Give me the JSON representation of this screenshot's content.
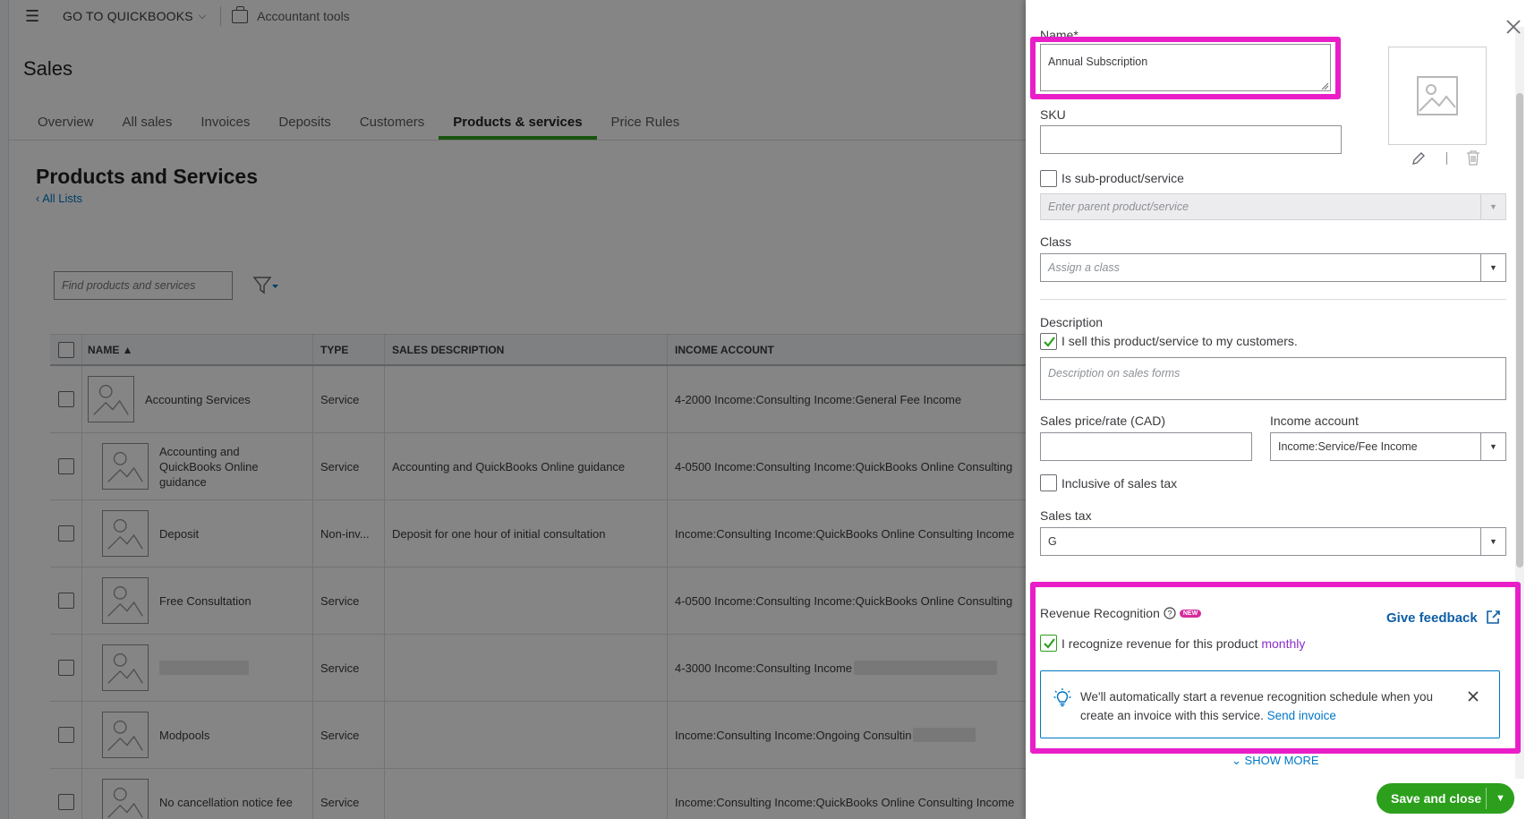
{
  "topbar": {
    "goto": "GO TO QUICKBOOKS",
    "accountant_tools": "Accountant tools"
  },
  "page": {
    "title": "Sales",
    "tabs": [
      {
        "label": "Overview",
        "active": false
      },
      {
        "label": "All sales",
        "active": false
      },
      {
        "label": "Invoices",
        "active": false
      },
      {
        "label": "Deposits",
        "active": false
      },
      {
        "label": "Customers",
        "active": false
      },
      {
        "label": "Products & services",
        "active": true
      },
      {
        "label": "Price Rules",
        "active": false
      }
    ],
    "section_title": "Products and Services",
    "back_link": "All Lists",
    "search_placeholder": "Find products and services"
  },
  "table": {
    "headers": {
      "name": "NAME ▲",
      "type": "TYPE",
      "description": "SALES DESCRIPTION",
      "income": "INCOME ACCOUNT"
    },
    "rows": [
      {
        "name": "Accounting Services",
        "type": "Service",
        "description": "",
        "income": "4-2000 Income:Consulting Income:General Fee Income"
      },
      {
        "name": "Accounting and QuickBooks Online guidance",
        "type": "Service",
        "description": "Accounting and QuickBooks Online guidance",
        "income": "4-0500 Income:Consulting Income:QuickBooks Online Consulting"
      },
      {
        "name": "Deposit",
        "type": "Non-inv...",
        "description": "Deposit for one hour of initial consultation",
        "income": "Income:Consulting Income:QuickBooks Online Consulting Income"
      },
      {
        "name": "Free Consultation",
        "type": "Service",
        "description": "",
        "income": "4-0500 Income:Consulting Income:QuickBooks Online Consulting"
      },
      {
        "name": "",
        "type": "Service",
        "description": "",
        "income": "4-3000 Income:Consulting Income"
      },
      {
        "name": "Modpools",
        "type": "Service",
        "description": "",
        "income": "Income:Consulting Income:Ongoing Consultin"
      },
      {
        "name": "No cancellation notice fee",
        "type": "Service",
        "description": "",
        "income": "Income:Consulting Income:QuickBooks Online Consulting Income"
      }
    ]
  },
  "drawer": {
    "name_label": "Name*",
    "name_value": "Annual Subscription",
    "sku_label": "SKU",
    "sku_value": "",
    "sub_product_label": "Is sub-product/service",
    "parent_placeholder": "Enter parent product/service",
    "class_label": "Class",
    "class_placeholder": "Assign a class",
    "description_label": "Description",
    "sell_label": "I sell this product/service to my customers.",
    "description_placeholder": "Description on sales forms",
    "price_label": "Sales price/rate (CAD)",
    "price_value": "",
    "income_label": "Income account",
    "income_value": "Income:Service/Fee Income",
    "inclusive_label": "Inclusive of sales tax",
    "sales_tax_label": "Sales tax",
    "sales_tax_value": "G",
    "revrec_label": "Revenue Recognition",
    "new_badge": "NEW",
    "give_feedback": "Give feedback",
    "recognize_label": "I recognize revenue for this product",
    "recognize_freq": "monthly",
    "info_text": "We'll automatically start a revenue recognition schedule when you create an invoice with this service.",
    "send_invoice": "Send invoice",
    "show_more": "SHOW MORE",
    "save_close": "Save and close"
  },
  "colors": {
    "accent_green": "#2ca01c",
    "link_blue": "#0077c5",
    "highlight_magenta": "#e91ec8",
    "feedback_blue": "#0d5fa6",
    "frequency_purple": "#8d2cc9"
  }
}
